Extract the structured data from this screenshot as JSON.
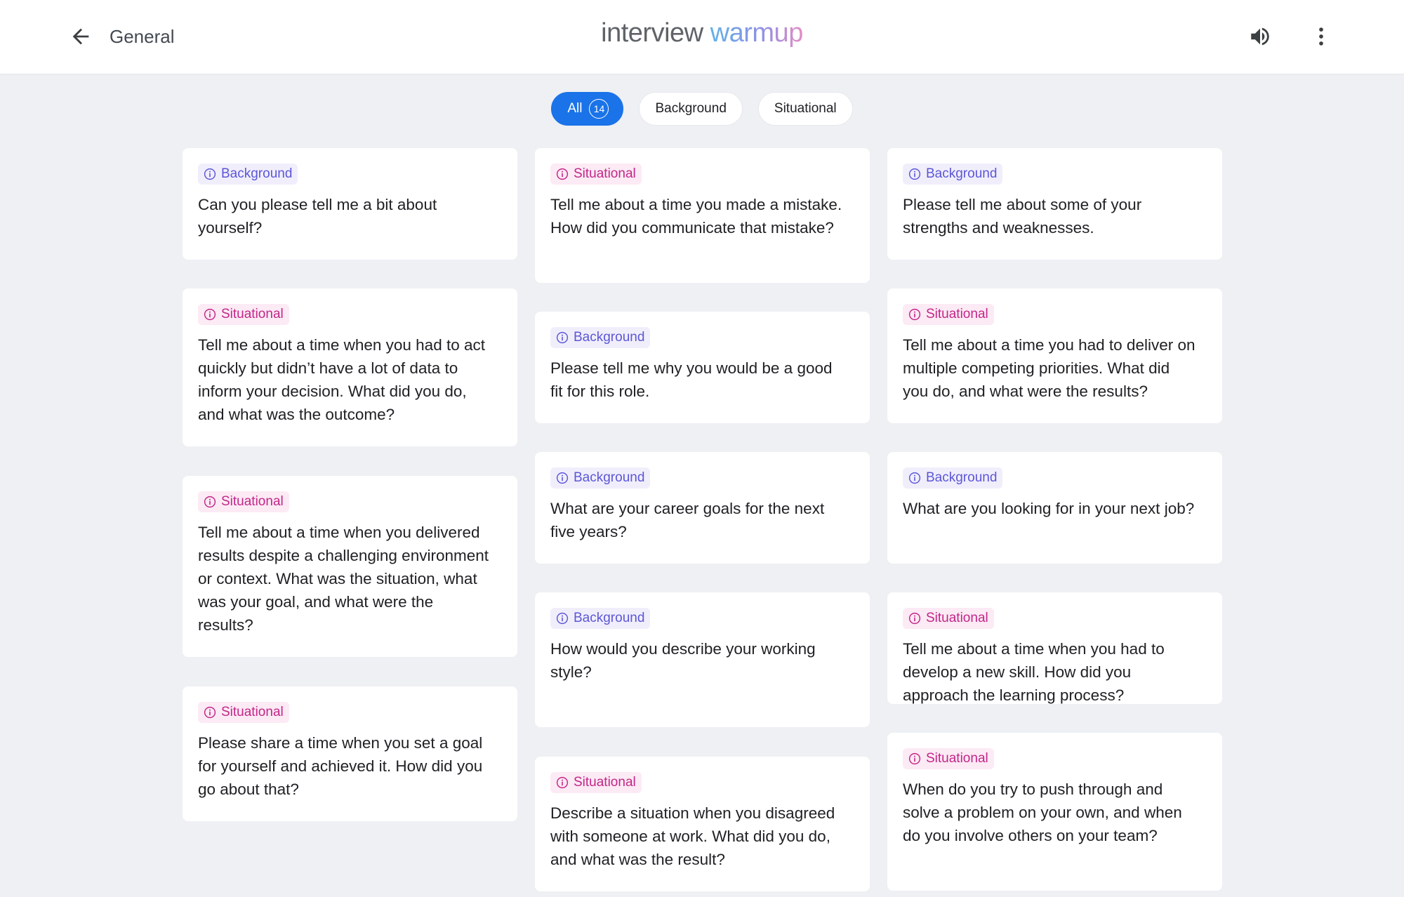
{
  "header": {
    "back_label": "General",
    "logo_part1": "interview",
    "logo_part2": "warmup"
  },
  "filters": [
    {
      "label": "All",
      "count": "14",
      "active": true
    },
    {
      "label": "Background",
      "active": false
    },
    {
      "label": "Situational",
      "active": false
    }
  ],
  "colors": {
    "accent": "#1a73e8",
    "background_tag": "#5b57d6",
    "situational_tag": "#c2268a"
  },
  "cards": [
    {
      "category": "Background",
      "text": "Can you please tell me a bit about yourself?"
    },
    {
      "category": "Situational",
      "text": "Tell me about a time you made a mistake. How did you communicate that mistake?"
    },
    {
      "category": "Background",
      "text": "Please tell me about some of your strengths and weaknesses."
    },
    {
      "category": "Situational",
      "text": "Tell me about a time when you had to act quickly but didn’t have a lot of data to inform your decision. What did you do, and what was the outcome?"
    },
    {
      "category": "Background",
      "text": "Please tell me why you would be a good fit for this role."
    },
    {
      "category": "Situational",
      "text": "Tell me about a time you had to deliver on multiple competing priorities. What did you do, and what were the results?"
    },
    {
      "category": "Situational",
      "text": "Tell me about a time when you delivered results despite a challenging environment or context. What was the situation, what was your goal, and what were the results?"
    },
    {
      "category": "Background",
      "text": "What are your career goals for the next five years?"
    },
    {
      "category": "Background",
      "text": "What are you looking for in your next job?"
    },
    {
      "category": "Situational",
      "text": "Please share a time when you set a goal for yourself and achieved it. How did you go about that?"
    },
    {
      "category": "Background",
      "text": "How would you describe your working style?"
    },
    {
      "category": "Situational",
      "text": "Tell me about a time when you had to develop a new skill. How did you approach the learning process?"
    },
    {
      "category": "Situational",
      "text": "Describe a situation when you disagreed with someone at work. What did you do, and what was the result?"
    },
    {
      "category": "Situational",
      "text": "When do you try to push through and solve a problem on your own, and when do you involve others on your team?"
    }
  ]
}
